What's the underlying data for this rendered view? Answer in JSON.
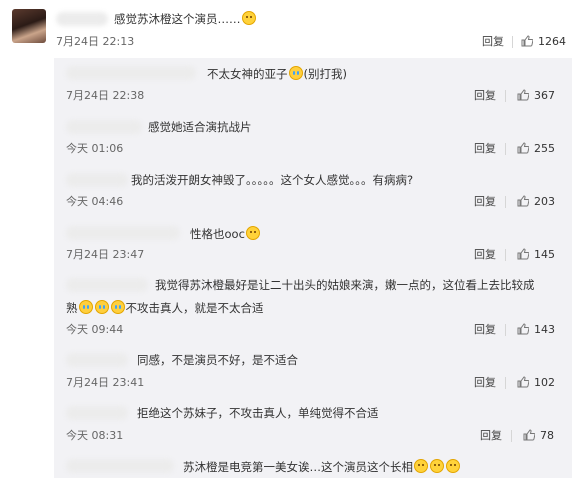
{
  "main_comment": {
    "text": "感觉苏沐橙这个演员……",
    "time": "7月24日 22:13",
    "reply_label": "回复",
    "likes": "1264"
  },
  "replies": [
    {
      "text": "不太女神的亚子",
      "suffix": "(别打我)",
      "time": "7月24日 22:38",
      "reply_label": "回复",
      "likes": "367"
    },
    {
      "text": "感觉她适合演抗战片",
      "time": "今天 01:06",
      "reply_label": "回复",
      "likes": "255"
    },
    {
      "text": "我的活泼开朗女神毁了。。。。。这个女人感觉。。。有病病?",
      "time": "今天 04:46",
      "reply_label": "回复",
      "likes": "203"
    },
    {
      "text": "性格也ooc",
      "time": "7月24日 23:47",
      "reply_label": "回复",
      "likes": "145"
    },
    {
      "text_line1": "我觉得苏沐橙最好是让二十出头的姑娘来演，嫩一点的，这位看上去比较成",
      "text_line2_start": "熟",
      "text_line2_end": "不攻击真人，就是不太合适",
      "time": "今天 09:44",
      "reply_label": "回复",
      "likes": "143"
    },
    {
      "text": "同感，不是演员不好，是不适合",
      "time": "7月24日 23:41",
      "reply_label": "回复",
      "likes": "102"
    },
    {
      "text": "拒绝这个苏妹子，不攻击真人，单纯觉得不合适",
      "time": "今天 08:31",
      "reply_label": "回复",
      "likes": "78"
    },
    {
      "text": "苏沐橙是电竞第一美女诶…这个演员这个长相"
    }
  ]
}
